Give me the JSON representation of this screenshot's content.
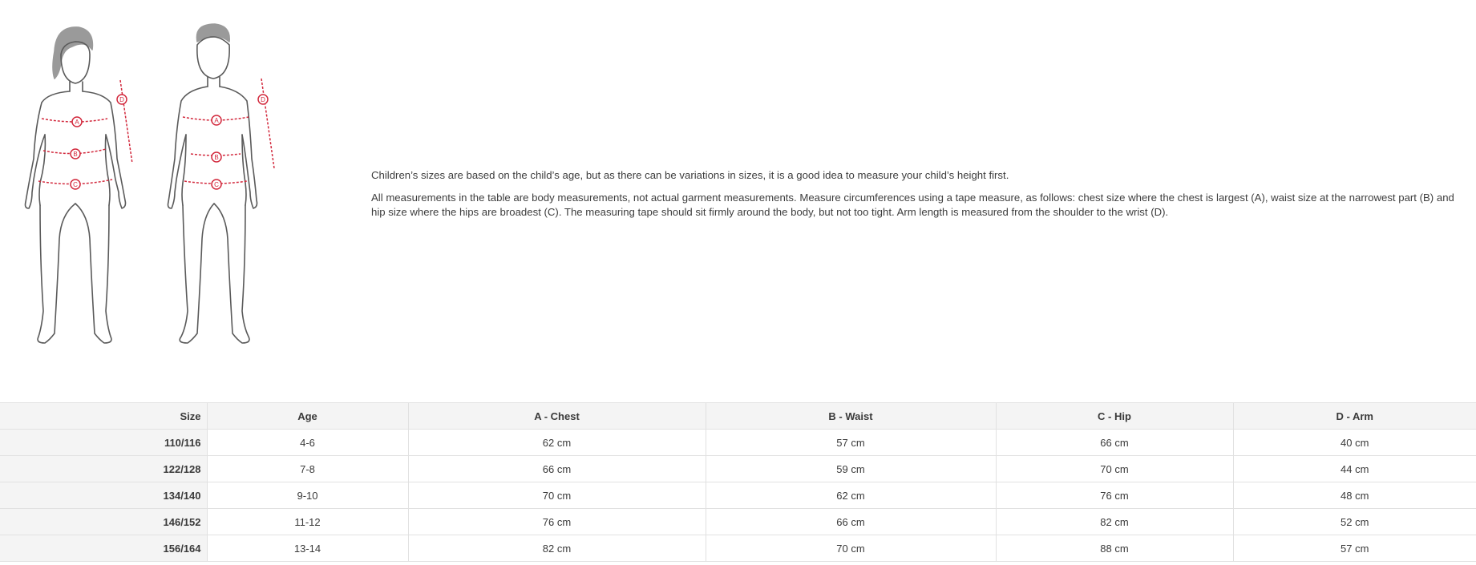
{
  "illustration": {
    "icons": [
      "girl-figure-icon",
      "boy-figure-icon"
    ],
    "markers": [
      "A",
      "B",
      "C",
      "D"
    ],
    "accent_color": "#d2283c",
    "outline_color": "#5a5a5a",
    "hair_color": "#9a9a9a"
  },
  "info": {
    "paragraph1": "Children’s sizes are based on the child’s age, but as there can be variations in sizes, it is a good idea to measure your child’s height first.",
    "paragraph2": "All measurements in the table are body measurements, not actual garment measurements. Measure circumferences using a tape measure, as follows: chest size where the chest is largest (A), waist size at the narrowest part (B) and hip size where the hips are broadest (C). The measuring tape should sit firmly around the body, but not too tight. Arm length is measured from the shoulder to the wrist (D)."
  },
  "table": {
    "headers": [
      "Size",
      "Age",
      "A - Chest",
      "B - Waist",
      "C - Hip",
      "D - Arm"
    ],
    "rows": [
      [
        "110/116",
        "4-6",
        "62 cm",
        "57 cm",
        "66 cm",
        "40 cm"
      ],
      [
        "122/128",
        "7-8",
        "66 cm",
        "59 cm",
        "70 cm",
        "44 cm"
      ],
      [
        "134/140",
        "9-10",
        "70 cm",
        "62 cm",
        "76 cm",
        "48 cm"
      ],
      [
        "146/152",
        "11-12",
        "76 cm",
        "66 cm",
        "82 cm",
        "52 cm"
      ],
      [
        "156/164",
        "13-14",
        "82 cm",
        "70 cm",
        "88 cm",
        "57 cm"
      ]
    ]
  }
}
